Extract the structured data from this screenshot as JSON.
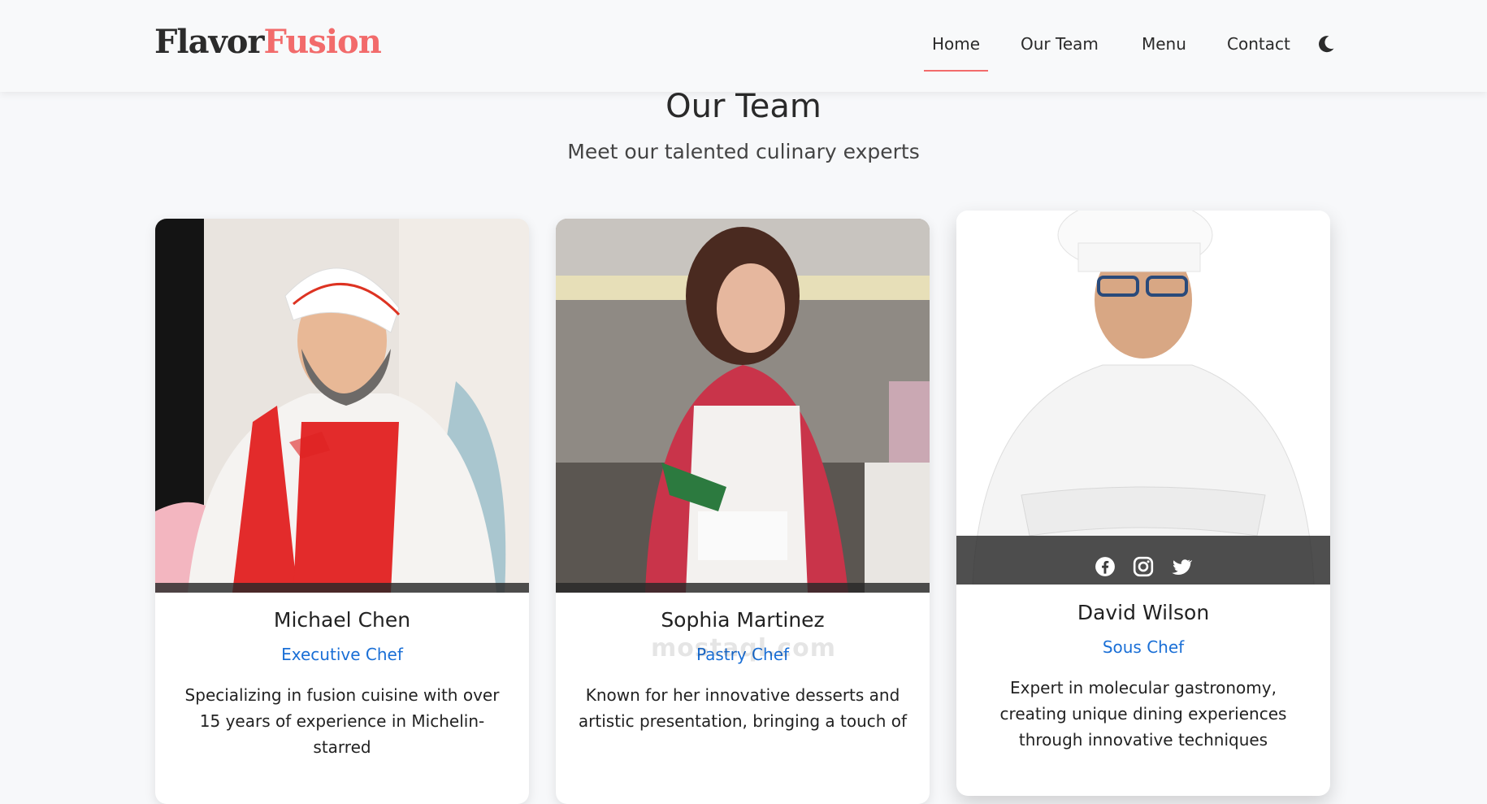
{
  "brand": {
    "part1": "Flavor",
    "part2": "Fusion"
  },
  "nav": {
    "items": [
      {
        "label": "Home",
        "active": true
      },
      {
        "label": "Our Team",
        "active": false
      },
      {
        "label": "Menu",
        "active": false
      },
      {
        "label": "Contact",
        "active": false
      }
    ],
    "theme_toggle_icon": "moon-icon"
  },
  "section": {
    "title": "Our Team",
    "subtitle": "Meet our talented culinary experts"
  },
  "team": [
    {
      "name": "Michael Chen",
      "role": "Executive Chef",
      "bio": "Specializing in fusion cuisine with over 15 years of experience in Michelin-starred"
    },
    {
      "name": "Sophia Martinez",
      "role": "Pastry Chef",
      "bio": "Known for her innovative desserts and artistic presentation, bringing a touch of"
    },
    {
      "name": "David Wilson",
      "role": "Sous Chef",
      "bio": "Expert in molecular gastronomy, creating unique dining experiences through innovative techniques",
      "social_icons": [
        "facebook-icon",
        "instagram-icon",
        "twitter-icon"
      ]
    }
  ],
  "watermark": "mostaql.com",
  "colors": {
    "accent": "#f26b6b",
    "role": "#1a6fd6",
    "dark": "#2b2b2b"
  }
}
